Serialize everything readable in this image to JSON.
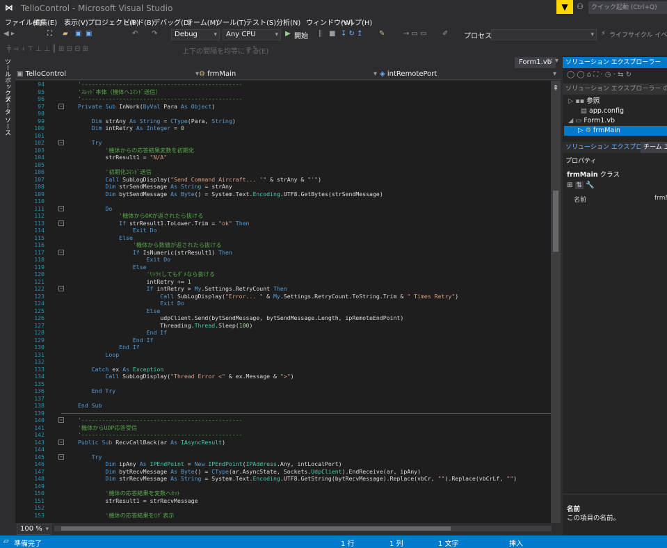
{
  "window": {
    "title": "TelloControl - Microsoft Visual Studio",
    "quick_launch": "クイック起動 (Ctrl+Q)"
  },
  "menu": [
    "ファイル(F)",
    "編集(E)",
    "表示(V)",
    "プロジェクト(P)",
    "ビルド(B)",
    "デバッグ(D)",
    "チーム(M)",
    "ツール(T)",
    "テスト(S)",
    "分析(N)",
    "ウィンドウ(W)",
    "ヘルプ(H)"
  ],
  "toolbar": {
    "config": "Debug",
    "platform": "Any CPU",
    "start_label": "開始",
    "process_label": "プロセス:",
    "process_value": "",
    "lifecycle": "ライフサイクル イベント",
    "align_label": "上下の間隔を均等にする(E)"
  },
  "left_tabs": [
    "ツールボックス",
    "データ ソース"
  ],
  "doc_tab": "Form1.vb",
  "nav": {
    "project": "TelloControl",
    "class": "frmMain",
    "member": "intRemotePort"
  },
  "code_lines": [
    {
      "n": 94,
      "t": [
        [
          "cm",
          "'-----------------------------------------------"
        ]
      ]
    },
    {
      "n": 95,
      "t": [
        [
          "cm",
          "'ｽﾚｯﾄﾞ本体（機体へｺﾏﾝﾄﾞ送信）"
        ]
      ]
    },
    {
      "n": 96,
      "t": [
        [
          "cm",
          "'-----------------------------------------------"
        ]
      ]
    },
    {
      "n": 97,
      "t": [
        [
          "kw",
          "Private Sub "
        ],
        [
          "tx",
          "InWork("
        ],
        [
          "kw",
          "ByVal "
        ],
        [
          "tx",
          "Para "
        ],
        [
          "kw",
          "As Object"
        ],
        [
          "tx",
          ")"
        ]
      ],
      "fold": true
    },
    {
      "n": 98,
      "t": []
    },
    {
      "n": 99,
      "t": [
        [
          "kw",
          "    Dim "
        ],
        [
          "tx",
          "strAny "
        ],
        [
          "kw",
          "As String"
        ],
        [
          "tx",
          " = "
        ],
        [
          "kw",
          "CType"
        ],
        [
          "tx",
          "(Para, "
        ],
        [
          "kw",
          "String"
        ],
        [
          "tx",
          ")"
        ]
      ]
    },
    {
      "n": 100,
      "t": [
        [
          "kw",
          "    Dim "
        ],
        [
          "tx",
          "intRetry "
        ],
        [
          "kw",
          "As Integer"
        ],
        [
          "tx",
          " = "
        ],
        [
          "nm",
          "0"
        ]
      ]
    },
    {
      "n": 101,
      "t": []
    },
    {
      "n": 102,
      "t": [
        [
          "kw",
          "    Try"
        ]
      ],
      "fold": true
    },
    {
      "n": 103,
      "t": [
        [
          "cm",
          "        '機体からの応答結果変数を初期化"
        ]
      ]
    },
    {
      "n": 104,
      "t": [
        [
          "tx",
          "        strResult1 = "
        ],
        [
          "str",
          "\"N/A\""
        ]
      ]
    },
    {
      "n": 105,
      "t": []
    },
    {
      "n": 106,
      "t": [
        [
          "cm",
          "        '初期化ｺﾏﾝﾄﾞ送信"
        ]
      ]
    },
    {
      "n": 107,
      "t": [
        [
          "kw",
          "        Call "
        ],
        [
          "tx",
          "SubLogDisplay("
        ],
        [
          "str",
          "\"Send Command Aircraft... '\""
        ],
        [
          "tx",
          " & strAny & "
        ],
        [
          "str",
          "\"'\""
        ],
        [
          "tx",
          ")"
        ]
      ]
    },
    {
      "n": 108,
      "t": [
        [
          "kw",
          "        Dim "
        ],
        [
          "tx",
          "strSendMessage "
        ],
        [
          "kw",
          "As String"
        ],
        [
          "tx",
          " = strAny"
        ]
      ]
    },
    {
      "n": 109,
      "t": [
        [
          "kw",
          "        Dim "
        ],
        [
          "tx",
          "bytSendMessage "
        ],
        [
          "kw",
          "As Byte"
        ],
        [
          "tx",
          "() = System.Text."
        ],
        [
          "tp",
          "Encoding"
        ],
        [
          "tx",
          ".UTF8.GetBytes(strSendMessage)"
        ]
      ]
    },
    {
      "n": 110,
      "t": []
    },
    {
      "n": 111,
      "t": [
        [
          "kw",
          "        Do"
        ]
      ],
      "fold": true
    },
    {
      "n": 112,
      "t": [
        [
          "cm",
          "            '機体からOKが返されたら抜ける"
        ]
      ]
    },
    {
      "n": 113,
      "t": [
        [
          "kw",
          "            If "
        ],
        [
          "tx",
          "strResult1.ToLower.Trim = "
        ],
        [
          "str",
          "\"ok\""
        ],
        [
          "kw",
          " Then"
        ]
      ],
      "fold": true
    },
    {
      "n": 114,
      "t": [
        [
          "kw",
          "                Exit Do"
        ]
      ]
    },
    {
      "n": 115,
      "t": [
        [
          "kw",
          "            Else"
        ]
      ]
    },
    {
      "n": 116,
      "t": [
        [
          "cm",
          "                '機体から数値が返されたら抜ける"
        ]
      ]
    },
    {
      "n": 117,
      "t": [
        [
          "kw",
          "                If "
        ],
        [
          "tx",
          "IsNumeric(strResult1) "
        ],
        [
          "kw",
          "Then"
        ]
      ],
      "fold": true
    },
    {
      "n": 118,
      "t": [
        [
          "kw",
          "                    Exit Do"
        ]
      ]
    },
    {
      "n": 119,
      "t": [
        [
          "kw",
          "                Else"
        ]
      ]
    },
    {
      "n": 120,
      "t": [
        [
          "cm",
          "                    'ﾘﾄﾗｲしてもﾀﾞﾒなら抜ける"
        ]
      ]
    },
    {
      "n": 121,
      "t": [
        [
          "tx",
          "                    intRetry += "
        ],
        [
          "nm",
          "1"
        ]
      ]
    },
    {
      "n": 122,
      "t": [
        [
          "kw",
          "                    If "
        ],
        [
          "tx",
          "intRetry > "
        ],
        [
          "kw",
          "My"
        ],
        [
          "tx",
          ".Settings.RetryCount "
        ],
        [
          "kw",
          "Then"
        ]
      ],
      "fold": true
    },
    {
      "n": 123,
      "t": [
        [
          "kw",
          "                        Call "
        ],
        [
          "tx",
          "SubLogDisplay("
        ],
        [
          "str",
          "\"Error... \""
        ],
        [
          "tx",
          " & "
        ],
        [
          "kw",
          "My"
        ],
        [
          "tx",
          ".Settings.RetryCount.ToString.Trim & "
        ],
        [
          "str",
          "\" Times Retry\""
        ],
        [
          "tx",
          ")"
        ]
      ]
    },
    {
      "n": 124,
      "t": [
        [
          "kw",
          "                        Exit Do"
        ]
      ]
    },
    {
      "n": 125,
      "t": [
        [
          "kw",
          "                    Else"
        ]
      ]
    },
    {
      "n": 126,
      "t": [
        [
          "tx",
          "                        udpClient.Send(bytSendMessage, bytSendMessage.Length, ipRemoteEndPoint)"
        ]
      ]
    },
    {
      "n": 127,
      "t": [
        [
          "tx",
          "                        Threading."
        ],
        [
          "tp",
          "Thread"
        ],
        [
          "tx",
          ".Sleep("
        ],
        [
          "nm",
          "100"
        ],
        [
          "tx",
          ")"
        ]
      ]
    },
    {
      "n": 128,
      "t": [
        [
          "kw",
          "                    End If"
        ]
      ]
    },
    {
      "n": 129,
      "t": [
        [
          "kw",
          "                End If"
        ]
      ]
    },
    {
      "n": 130,
      "t": [
        [
          "kw",
          "            End If"
        ]
      ]
    },
    {
      "n": 131,
      "t": [
        [
          "kw",
          "        Loop"
        ]
      ]
    },
    {
      "n": 132,
      "t": []
    },
    {
      "n": 133,
      "t": [
        [
          "kw",
          "    Catch "
        ],
        [
          "tx",
          "ex "
        ],
        [
          "kw",
          "As "
        ],
        [
          "tp",
          "Exception"
        ]
      ]
    },
    {
      "n": 134,
      "t": [
        [
          "kw",
          "        Call "
        ],
        [
          "tx",
          "SubLogDisplay("
        ],
        [
          "str",
          "\"Thread Error <\""
        ],
        [
          "tx",
          " & ex.Message & "
        ],
        [
          "str",
          "\">\""
        ],
        [
          "tx",
          ")"
        ]
      ]
    },
    {
      "n": 135,
      "t": []
    },
    {
      "n": 136,
      "t": [
        [
          "kw",
          "    End Try"
        ]
      ]
    },
    {
      "n": 137,
      "t": []
    },
    {
      "n": 138,
      "t": [
        [
          "kw",
          "End Sub"
        ]
      ]
    },
    {
      "n": 139,
      "t": [],
      "sep": true
    },
    {
      "n": 140,
      "t": [
        [
          "cm",
          "'-----------------------------------------------"
        ]
      ],
      "fold": true
    },
    {
      "n": 141,
      "t": [
        [
          "cm",
          "'機体からUDP応答受信"
        ]
      ]
    },
    {
      "n": 142,
      "t": [
        [
          "cm",
          "'-----------------------------------------------"
        ]
      ]
    },
    {
      "n": 143,
      "t": [
        [
          "kw",
          "Public Sub "
        ],
        [
          "tx",
          "RecvCallBack(ar "
        ],
        [
          "kw",
          "As "
        ],
        [
          "tp",
          "IAsyncResult"
        ],
        [
          "tx",
          ")"
        ]
      ],
      "fold": true
    },
    {
      "n": 144,
      "t": []
    },
    {
      "n": 145,
      "t": [
        [
          "kw",
          "    Try"
        ]
      ],
      "fold": true
    },
    {
      "n": 146,
      "t": [
        [
          "kw",
          "        Dim "
        ],
        [
          "tx",
          "ipAny "
        ],
        [
          "kw",
          "As "
        ],
        [
          "tp",
          "IPEndPoint"
        ],
        [
          "tx",
          " = "
        ],
        [
          "kw",
          "New "
        ],
        [
          "tp",
          "IPEndPoint"
        ],
        [
          "tx",
          "("
        ],
        [
          "tp",
          "IPAddress"
        ],
        [
          "tx",
          ".Any, intLocalPort)"
        ]
      ]
    },
    {
      "n": 147,
      "t": [
        [
          "kw",
          "        Dim "
        ],
        [
          "tx",
          "bytRecvMessage "
        ],
        [
          "kw",
          "As Byte"
        ],
        [
          "tx",
          "() = "
        ],
        [
          "kw",
          "CType"
        ],
        [
          "tx",
          "(ar.AsyncState, Sockets."
        ],
        [
          "tp",
          "UdpClient"
        ],
        [
          "tx",
          ").EndReceive(ar, ipAny)"
        ]
      ]
    },
    {
      "n": 148,
      "t": [
        [
          "kw",
          "        Dim "
        ],
        [
          "tx",
          "strRecvMessage "
        ],
        [
          "kw",
          "As String"
        ],
        [
          "tx",
          " = System.Text."
        ],
        [
          "tp",
          "Encoding"
        ],
        [
          "tx",
          ".UTF8.GetString(bytRecvMessage).Replace(vbCr, "
        ],
        [
          "str",
          "\"\""
        ],
        [
          "tx",
          ").Replace(vbCrLf, "
        ],
        [
          "str",
          "\"\""
        ],
        [
          "tx",
          ")"
        ]
      ]
    },
    {
      "n": 149,
      "t": []
    },
    {
      "n": 150,
      "t": [
        [
          "cm",
          "        '機体の応答結果を変数へｾｯﾄ"
        ]
      ]
    },
    {
      "n": 151,
      "t": [
        [
          "tx",
          "        strResult1 = strRecvMessage"
        ]
      ]
    },
    {
      "n": 152,
      "t": []
    },
    {
      "n": 153,
      "t": [
        [
          "cm",
          "        '機体の応答結果をﾛｸﾞ表示"
        ]
      ]
    }
  ],
  "editor": {
    "zoom": "100 %"
  },
  "solution_explorer": {
    "title": "ソリューション エクスプローラー",
    "search": "ソリューション エクスプローラー の検索 (Ctrl",
    "items": [
      {
        "label": "参照",
        "level": 1
      },
      {
        "label": "app.config",
        "level": 1
      },
      {
        "label": "Form1.vb",
        "level": 1
      },
      {
        "label": "frmMain",
        "level": 2
      }
    ],
    "tab1": "ソリューション エクスプローラー",
    "tab2": "チーム エ"
  },
  "properties": {
    "title": "プロパティ",
    "object": "frmMain",
    "object_type": "クラス",
    "col_name": "名前",
    "col_value": "frmMai",
    "desc_title": "名前",
    "desc_text": "この項目の名前。"
  },
  "status": {
    "ready": "準備完了",
    "line": "1 行",
    "col": "1 列",
    "char": "1 文字",
    "mode": "挿入"
  }
}
